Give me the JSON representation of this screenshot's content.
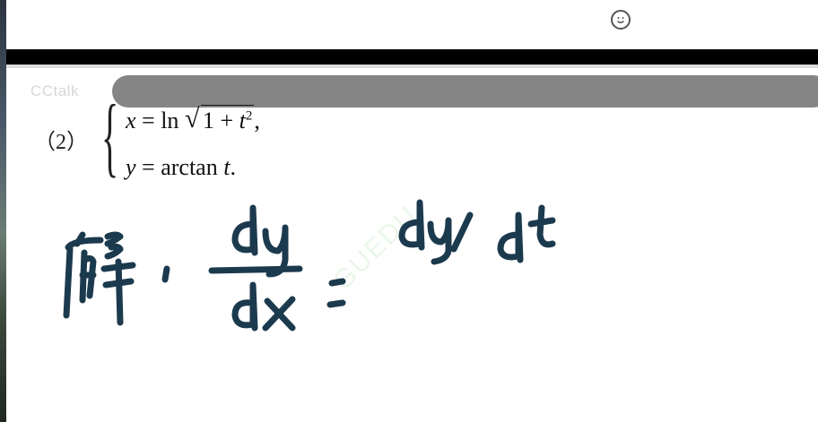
{
  "top_bar": {
    "smile_glyph": "☺",
    "smile_icon": "smiley-face-icon"
  },
  "toolbar": {
    "visible": true
  },
  "watermark": {
    "brand": "CCtalk",
    "diagonal": "GUEDU"
  },
  "problem": {
    "number": "（2）",
    "brace": "{",
    "eq1": {
      "var": "x",
      "lhs_eq": " = ln ",
      "radicand_a": "1 + ",
      "radicand_var": "t",
      "exp": "2",
      "suffix": ","
    },
    "eq2": {
      "var": "y",
      "rest": " = arctan ",
      "tail_var": "t",
      "tail": "."
    }
  },
  "handwriting": {
    "solve_label": "解:",
    "fraction": {
      "numerator": "dy",
      "denominator": "dx"
    },
    "equals": "=",
    "rhs": "dy/dt"
  },
  "colors": {
    "ink": "#1c3a4e",
    "toolbar": "#858585",
    "band": "#000000"
  }
}
